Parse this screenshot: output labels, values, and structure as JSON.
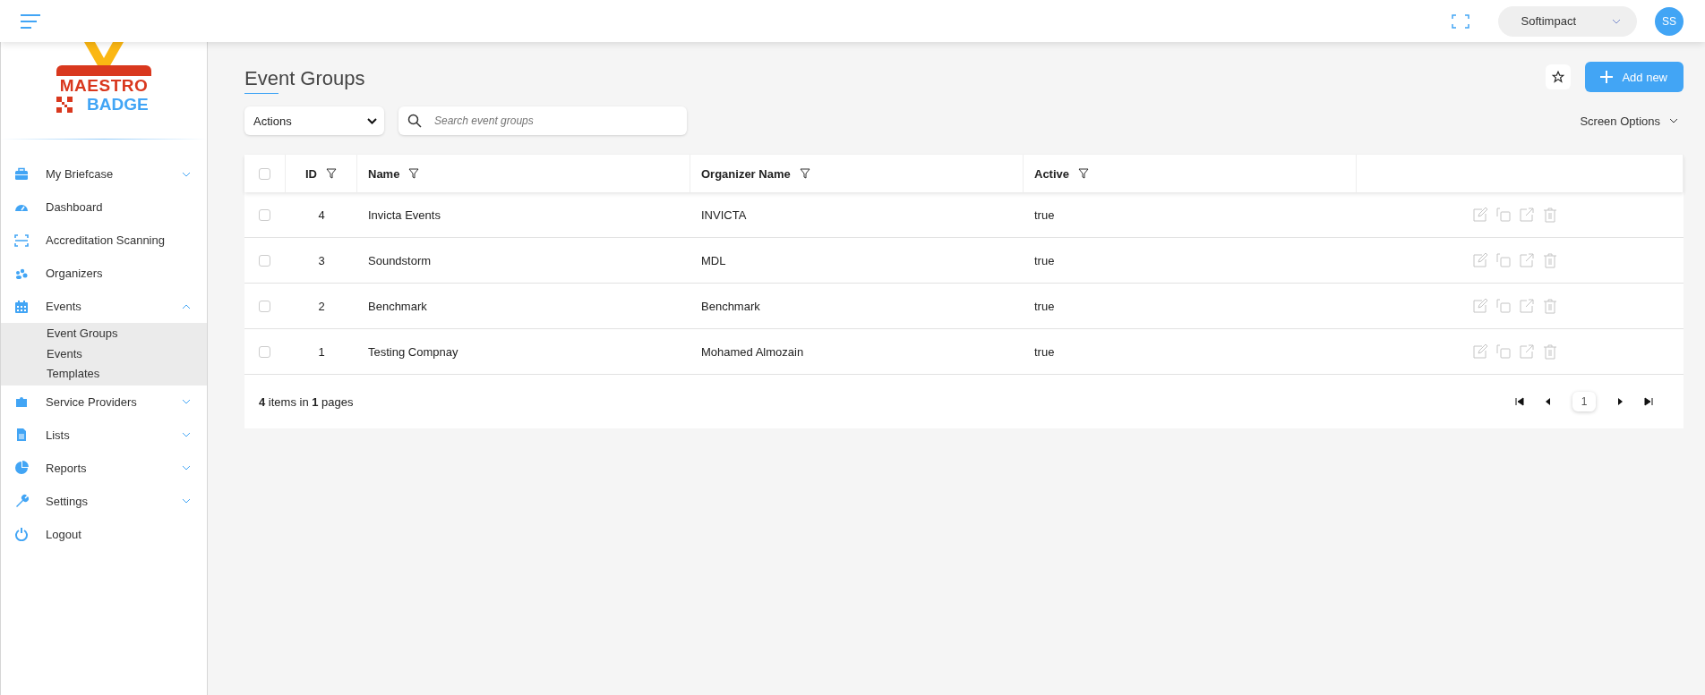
{
  "topbar": {
    "company": "Softimpact",
    "avatar": "SS"
  },
  "logo": {
    "line1": "MAESTRO",
    "line2": "BADGE"
  },
  "sidebar": {
    "items": [
      {
        "label": "My Briefcase",
        "kind": "group",
        "expanded": false
      },
      {
        "label": "Dashboard",
        "kind": "link"
      },
      {
        "label": "Accreditation Scanning",
        "kind": "link"
      },
      {
        "label": "Organizers",
        "kind": "link"
      },
      {
        "label": "Events",
        "kind": "group",
        "expanded": true,
        "children": [
          {
            "label": "Event Groups"
          },
          {
            "label": "Events"
          },
          {
            "label": "Templates"
          }
        ]
      },
      {
        "label": "Service Providers",
        "kind": "group",
        "expanded": false
      },
      {
        "label": "Lists",
        "kind": "group",
        "expanded": false
      },
      {
        "label": "Reports",
        "kind": "group",
        "expanded": false
      },
      {
        "label": "Settings",
        "kind": "group",
        "expanded": false
      },
      {
        "label": "Logout",
        "kind": "link"
      }
    ]
  },
  "page": {
    "title": "Event Groups",
    "add_button": "Add new",
    "actions_select": "Actions",
    "search": {
      "placeholder": "Search event groups"
    },
    "screen_options": "Screen Options"
  },
  "table": {
    "header_checked": false,
    "columns": [
      {
        "label": "ID",
        "filter": true
      },
      {
        "label": "Name",
        "filter": true
      },
      {
        "label": "Organizer Name",
        "filter": true
      },
      {
        "label": "Active",
        "filter": true
      }
    ],
    "rows": [
      {
        "checked": false,
        "id": "4",
        "name": "Invicta Events",
        "organizer": "INVICTA",
        "active": "true"
      },
      {
        "checked": false,
        "id": "3",
        "name": "Soundstorm",
        "organizer": "MDL",
        "active": "true"
      },
      {
        "checked": false,
        "id": "2",
        "name": "Benchmark",
        "organizer": "Benchmark",
        "active": "true"
      },
      {
        "checked": false,
        "id": "1",
        "name": "Testing Compnay",
        "organizer": "Mohamed Almozain",
        "active": "true"
      }
    ]
  },
  "pagination": {
    "summary": "**4** items in **1** pages",
    "pages": [
      {
        "label": "1",
        "selected": true
      }
    ]
  }
}
